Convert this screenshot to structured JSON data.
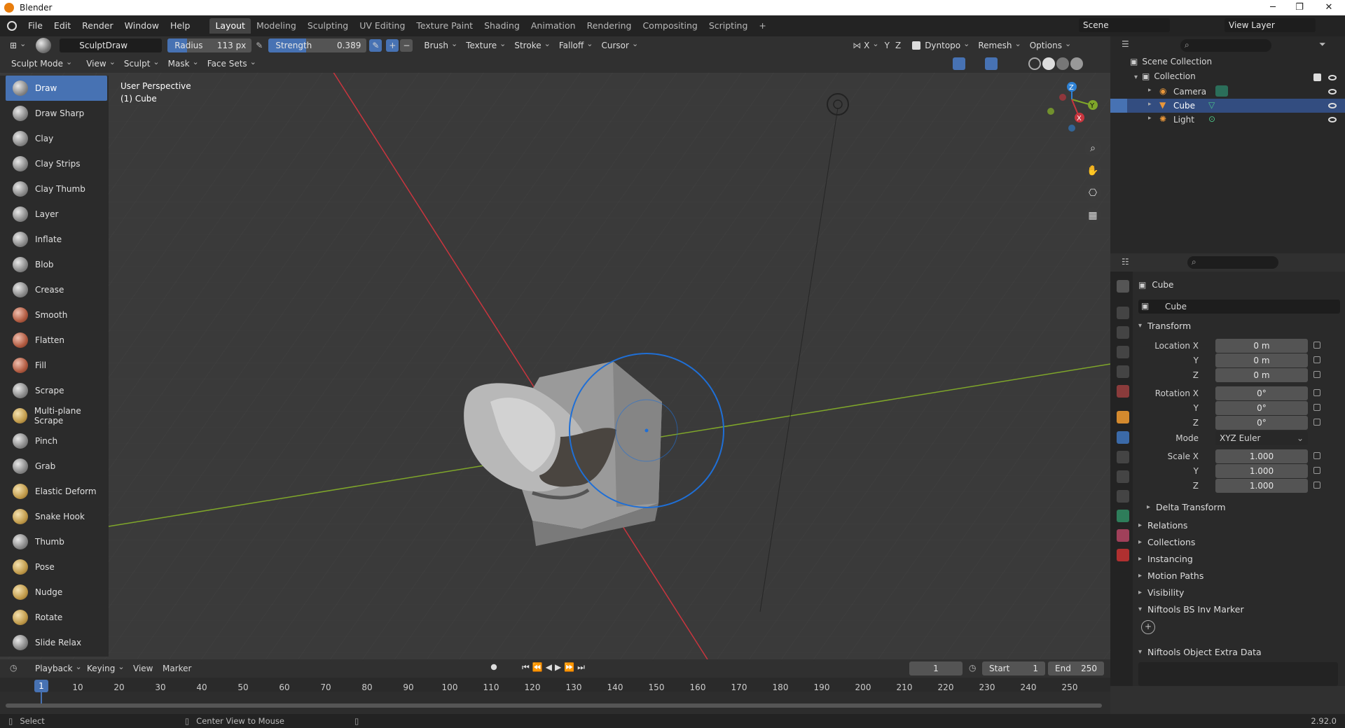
{
  "window": {
    "title": "Blender",
    "min": "─",
    "max": "❐",
    "close": "✕"
  },
  "menu": [
    "File",
    "Edit",
    "Render",
    "Window",
    "Help"
  ],
  "workspaces": [
    "Layout",
    "Modeling",
    "Sculpting",
    "UV Editing",
    "Texture Paint",
    "Shading",
    "Animation",
    "Rendering",
    "Compositing",
    "Scripting"
  ],
  "workspace_add": "+",
  "scene": {
    "name": "Scene",
    "layer": "View Layer"
  },
  "toolhdr": {
    "brush": "SculptDraw",
    "radius_label": "Radius",
    "radius_value": "113 px",
    "strength_label": "Strength",
    "strength_value": "0.389",
    "plus": "+",
    "minus": "−",
    "brush_menu": "Brush",
    "texture": "Texture",
    "stroke": "Stroke",
    "falloff": "Falloff",
    "cursor": "Cursor",
    "x": "X",
    "y": "Y",
    "z": "Z",
    "dyntopo": "Dyntopo",
    "remesh": "Remesh",
    "options": "Options"
  },
  "modehdr": {
    "mode": "Sculpt Mode",
    "view": "View",
    "sculpt": "Sculpt",
    "mask": "Mask",
    "face_sets": "Face Sets"
  },
  "viewport": {
    "perspective": "User Perspective",
    "object": "(1) Cube",
    "gizmo_z": "Z",
    "gizmo_y": "Y",
    "gizmo_x": "X"
  },
  "tools": [
    {
      "label": "Draw",
      "icon": "grey"
    },
    {
      "label": "Draw Sharp",
      "icon": "grey"
    },
    {
      "label": "Clay",
      "icon": "grey"
    },
    {
      "label": "Clay Strips",
      "icon": "grey"
    },
    {
      "label": "Clay Thumb",
      "icon": "grey"
    },
    {
      "label": "Layer",
      "icon": "grey"
    },
    {
      "label": "Inflate",
      "icon": "grey"
    },
    {
      "label": "Blob",
      "icon": "grey"
    },
    {
      "label": "Crease",
      "icon": "grey"
    },
    {
      "label": "Smooth",
      "icon": "red"
    },
    {
      "label": "Flatten",
      "icon": "red"
    },
    {
      "label": "Fill",
      "icon": "red"
    },
    {
      "label": "Scrape",
      "icon": "grey"
    },
    {
      "label": "Multi-plane Scrape",
      "icon": "gold"
    },
    {
      "label": "Pinch",
      "icon": "grey"
    },
    {
      "label": "Grab",
      "icon": "grey"
    },
    {
      "label": "Elastic Deform",
      "icon": "gold"
    },
    {
      "label": "Snake Hook",
      "icon": "gold"
    },
    {
      "label": "Thumb",
      "icon": "grey"
    },
    {
      "label": "Pose",
      "icon": "gold"
    },
    {
      "label": "Nudge",
      "icon": "gold"
    },
    {
      "label": "Rotate",
      "icon": "gold"
    },
    {
      "label": "Slide Relax",
      "icon": "grey"
    }
  ],
  "outliner": {
    "root": "Scene Collection",
    "collection": "Collection",
    "items": [
      "Camera",
      "Cube",
      "Light"
    ]
  },
  "props": {
    "object_name": "Cube",
    "datablock": "Cube",
    "transform": "Transform",
    "location_x_label": "Location X",
    "y_label": "Y",
    "z_label": "Z",
    "loc_x": "0 m",
    "loc_y": "0 m",
    "loc_z": "0 m",
    "rotation_x_label": "Rotation X",
    "rot_x": "0°",
    "rot_y": "0°",
    "rot_z": "0°",
    "mode_label": "Mode",
    "mode": "XYZ Euler",
    "scale_x_label": "Scale X",
    "sc_x": "1.000",
    "sc_y": "1.000",
    "sc_z": "1.000",
    "delta": "Delta Transform",
    "sections": [
      "Relations",
      "Collections",
      "Instancing",
      "Motion Paths",
      "Visibility"
    ],
    "niftools_marker": "Niftools BS Inv Marker",
    "niftools_extra": "Niftools Object Extra Data"
  },
  "timeline": {
    "playback": "Playback",
    "keying": "Keying",
    "view": "View",
    "marker": "Marker",
    "current": "1",
    "start_label": "Start",
    "start": "1",
    "end_label": "End",
    "end": "250",
    "ticks": [
      "10",
      "20",
      "30",
      "40",
      "50",
      "60",
      "70",
      "80",
      "90",
      "100",
      "110",
      "120",
      "130",
      "140",
      "150",
      "160",
      "170",
      "180",
      "190",
      "200",
      "210",
      "220",
      "230",
      "240",
      "250"
    ],
    "playhead": "1"
  },
  "status": {
    "select": "Select",
    "center": "Center View to Mouse",
    "version": "2.92.0"
  },
  "colors": {
    "accent": "#4772b3",
    "brush_circle": "#1f6fd6",
    "x_axis": "#c9353e",
    "y_axis": "#7fa62a"
  }
}
